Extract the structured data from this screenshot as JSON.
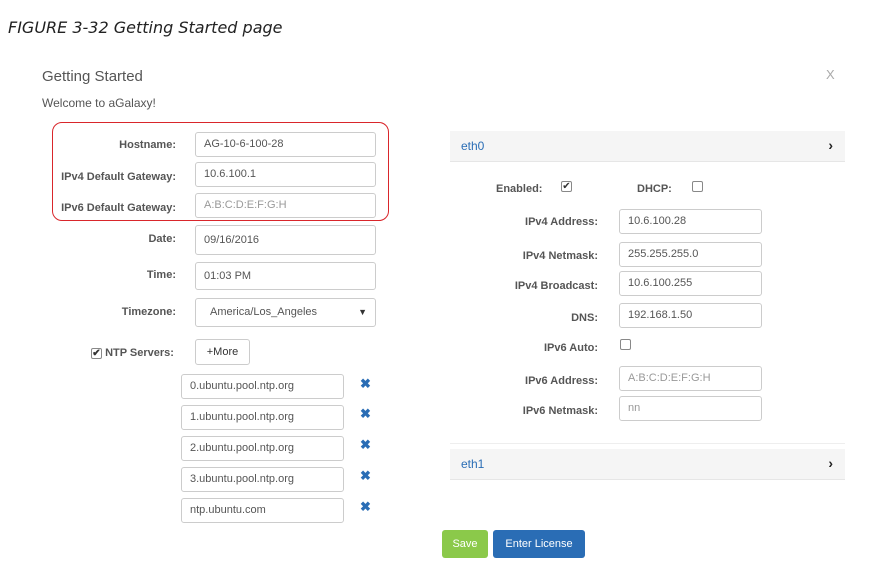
{
  "caption": "FIGURE 3-32  Getting Started page",
  "dialog": {
    "title": "Getting Started",
    "welcome": "Welcome to aGalaxy!",
    "close": "X"
  },
  "form": {
    "hostname_label": "Hostname:",
    "hostname": "AG-10-6-100-28",
    "ipv4_gw_label": "IPv4 Default Gateway:",
    "ipv4_gw": "10.6.100.1",
    "ipv6_gw_label": "IPv6 Default Gateway:",
    "ipv6_gw_placeholder": "A:B:C:D:E:F:G:H",
    "date_label": "Date:",
    "date": "09/16/2016",
    "time_label": "Time:",
    "time": "01:03 PM",
    "timezone_label": "Timezone:",
    "timezone": "America/Los_Angeles",
    "ntp_label": "NTP Servers:",
    "ntp_checked": true,
    "more_label": "+More",
    "ntp_servers": [
      "0.ubuntu.pool.ntp.org",
      "1.ubuntu.pool.ntp.org",
      "2.ubuntu.pool.ntp.org",
      "3.ubuntu.pool.ntp.org",
      "ntp.ubuntu.com"
    ]
  },
  "eth0": {
    "title": "eth0",
    "enabled_label": "Enabled:",
    "enabled": true,
    "dhcp_label": "DHCP:",
    "dhcp": false,
    "ipv4_addr_label": "IPv4 Address:",
    "ipv4_addr": "10.6.100.28",
    "ipv4_mask_label": "IPv4 Netmask:",
    "ipv4_mask": "255.255.255.0",
    "ipv4_bcast_label": "IPv4 Broadcast:",
    "ipv4_bcast": "10.6.100.255",
    "dns_label": "DNS:",
    "dns": "192.168.1.50",
    "ipv6_auto_label": "IPv6 Auto:",
    "ipv6_auto": false,
    "ipv6_addr_label": "IPv6 Address:",
    "ipv6_addr_placeholder": "A:B:C:D:E:F:G:H",
    "ipv6_mask_label": "IPv6 Netmask:",
    "ipv6_mask_placeholder": "nn"
  },
  "eth1": {
    "title": "eth1"
  },
  "buttons": {
    "save": "Save",
    "license": "Enter License"
  },
  "icons": {
    "remove": "remove-icon",
    "chevron": "chevron-right-icon",
    "select_arrow": "caret-down-icon"
  },
  "colors": {
    "accent": "#2a6db5",
    "save": "#8bc94a",
    "highlight": "#d9262b"
  }
}
